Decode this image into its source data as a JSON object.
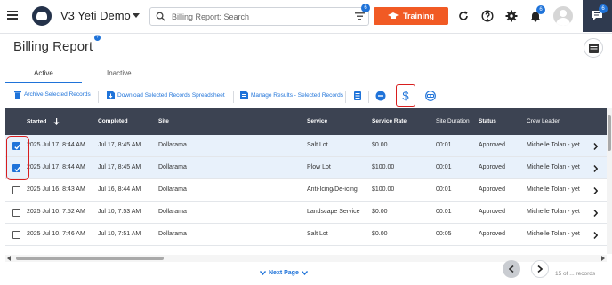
{
  "app": {
    "title": "V3 Yeti Demo"
  },
  "search": {
    "placeholder": "Billing Report: Search",
    "filter_badge": "6"
  },
  "training": {
    "label": "Training"
  },
  "notifications": {
    "badge": "6"
  },
  "chat": {
    "badge": "6"
  },
  "page": {
    "title": "Billing Report",
    "help_glyph": "?"
  },
  "tabs": [
    {
      "label": "Active",
      "active": true
    },
    {
      "label": "Inactive",
      "active": false
    }
  ],
  "toolbar": {
    "archive_label": "Archive Selected Records",
    "download_label": "Download Selected Records Spreadsheet",
    "manage_label": "Manage Results - Selected Records"
  },
  "table": {
    "columns": [
      "Started",
      "Completed",
      "Site",
      "Service",
      "Service Rate",
      "Site Duration",
      "Status",
      "Crew Leader"
    ],
    "rows": [
      {
        "checked": true,
        "started": "2025 Jul 17, 8:44 AM",
        "completed": "Jul 17, 8:45 AM",
        "site": "Dollarama",
        "service": "Salt Lot",
        "rate": "$0.00",
        "duration": "00:01",
        "status": "Approved",
        "crew": "Michelle Tolan - yet"
      },
      {
        "checked": true,
        "started": "2025 Jul 17, 8:44 AM",
        "completed": "Jul 17, 8:45 AM",
        "site": "Dollarama",
        "service": "Plow Lot",
        "rate": "$100.00",
        "duration": "00:01",
        "status": "Approved",
        "crew": "Michelle Tolan - yet"
      },
      {
        "checked": false,
        "started": "2025 Jul 16, 8:43 AM",
        "completed": "Jul 16, 8:44 AM",
        "site": "Dollarama",
        "service": "Anti-Icing/De-icing",
        "rate": "$100.00",
        "duration": "00:01",
        "status": "Approved",
        "crew": "Michelle Tolan - yet"
      },
      {
        "checked": false,
        "started": "2025 Jul 10, 7:52 AM",
        "completed": "Jul 10, 7:53 AM",
        "site": "Dollarama",
        "service": "Landscape Service",
        "rate": "$0.00",
        "duration": "00:01",
        "status": "Approved",
        "crew": "Michelle Tolan - yet"
      },
      {
        "checked": false,
        "started": "2025 Jul 10, 7:46 AM",
        "completed": "Jul 10, 7:51 AM",
        "site": "Dollarama",
        "service": "Salt Lot",
        "rate": "$0.00",
        "duration": "00:05",
        "status": "Approved",
        "crew": "Michelle Tolan - yet"
      }
    ]
  },
  "footer": {
    "next_page": "Next Page",
    "records": "15 of ... records"
  },
  "colors": {
    "accent": "#1f73d9",
    "training": "#f15a24",
    "header_bg": "#3c4352",
    "highlight": "#d81e1e"
  }
}
